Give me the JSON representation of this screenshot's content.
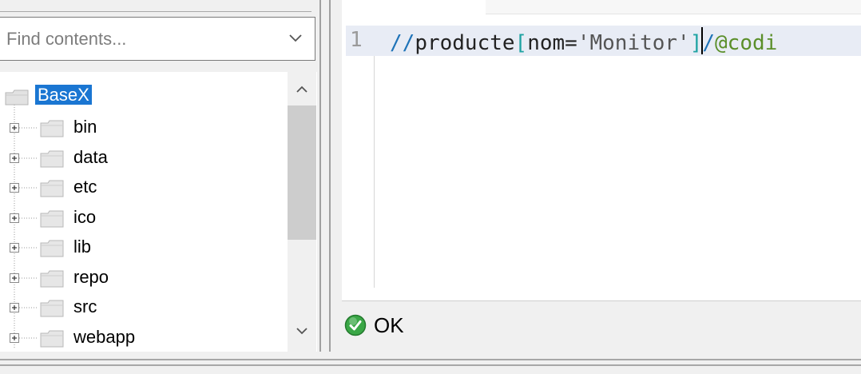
{
  "search": {
    "placeholder": "Find contents..."
  },
  "tree": {
    "root": "BaseX",
    "items": [
      {
        "label": "bin"
      },
      {
        "label": "data"
      },
      {
        "label": "etc"
      },
      {
        "label": "ico"
      },
      {
        "label": "lib"
      },
      {
        "label": "repo"
      },
      {
        "label": "src"
      },
      {
        "label": "webapp"
      }
    ]
  },
  "editor": {
    "line_number": "1",
    "tokens": {
      "slashes": "//",
      "element": "producte",
      "open_bracket": "[",
      "predicate": "nom=",
      "string": "'Monitor'",
      "close_bracket": "]",
      "slash2": "/",
      "attr": "@codi"
    }
  },
  "status": {
    "text": "OK",
    "color": "#2e9e3a"
  },
  "icons": {
    "folder": "folder-icon",
    "expander": "plus-box-icon",
    "status": "check-circle-icon"
  }
}
